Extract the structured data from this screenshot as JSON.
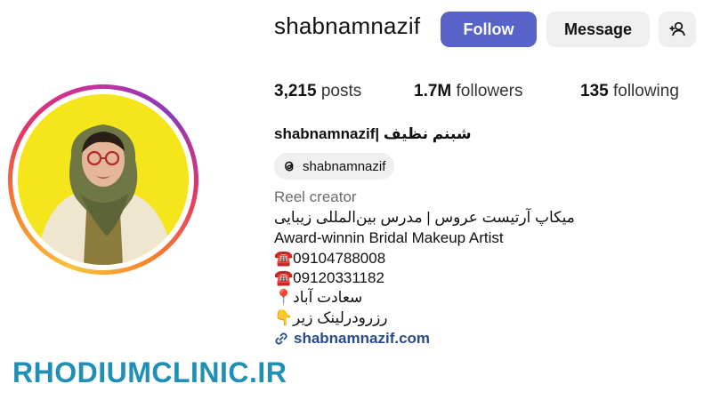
{
  "profile": {
    "username": "shabnamnazif",
    "full_name": "shabnamnazif| شبنم نظیف",
    "threads_handle": "shabnamnazif",
    "category": "Reel creator",
    "bio_lines": [
      "میکاپ آرتیست عروس | مدرس بین‌المللی زیبایی",
      "Award-winnin Bridal Makeup Artist",
      "☎️09104788008",
      "☎️09120331182",
      "📍سعادت آباد",
      "👇رزرودرلینک زیر"
    ],
    "link_text": "shabnamnazif.com"
  },
  "actions": {
    "follow_label": "Follow",
    "message_label": "Message"
  },
  "stats": {
    "posts_value": "3,215",
    "posts_label": " posts",
    "followers_value": "1.7M",
    "followers_label": " followers",
    "following_value": "135",
    "following_label": " following"
  },
  "watermark": "RHODIUMCLINIC.IR",
  "icons": {
    "add_user": "add-user-icon",
    "threads": "threads-icon",
    "link": "link-icon"
  },
  "colors": {
    "follow_button": "#5763c9",
    "secondary_button": "#efefef",
    "link": "#284b8c",
    "watermark": "#1f8fb5",
    "avatar_background": "#f4e61a"
  }
}
